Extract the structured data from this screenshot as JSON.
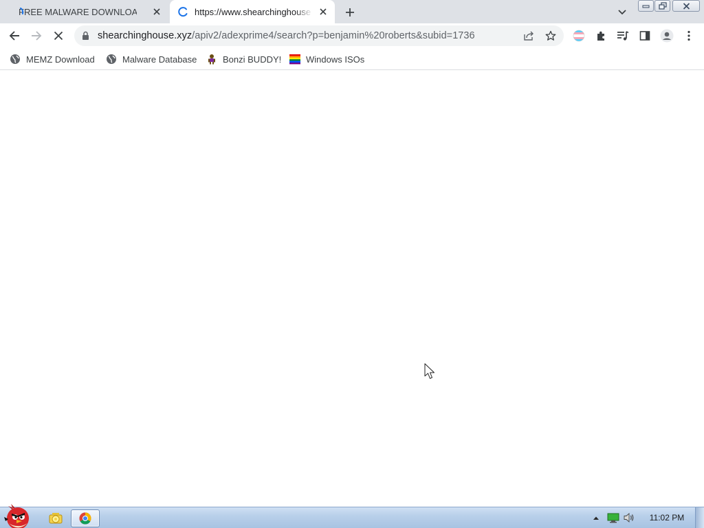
{
  "browser": {
    "tabs": [
      {
        "title": "FREE MALWARE DOWNLOAD",
        "active": false,
        "loading": true
      },
      {
        "title": "https://www.shearchinghouse",
        "active": true,
        "loading": true
      }
    ],
    "address": {
      "host": "shearchinghouse.xyz",
      "path": "/apiv2/adexprime4/search?p=benjamin%20roberts&subid=1736"
    },
    "bookmarks": [
      {
        "label": "MEMZ Download",
        "icon": "globe-icon"
      },
      {
        "label": "Malware Database",
        "icon": "globe-icon"
      },
      {
        "label": "Bonzi BUDDY!",
        "icon": "bonzi-icon"
      },
      {
        "label": "Windows ISOs",
        "icon": "windows-flag-icon"
      }
    ],
    "colors": {
      "tabstrip": "#dee1e6",
      "toolbar": "#ffffff",
      "omnibox": "#f1f3f4",
      "spinner": "#1a73e8"
    }
  },
  "taskbar": {
    "clock": "11:02 PM",
    "apps": [
      "angry-bird-start-icon",
      "explorer-icon",
      "chrome-icon"
    ],
    "tray": [
      "show-hidden-icons",
      "network-icon",
      "volume-icon"
    ]
  }
}
